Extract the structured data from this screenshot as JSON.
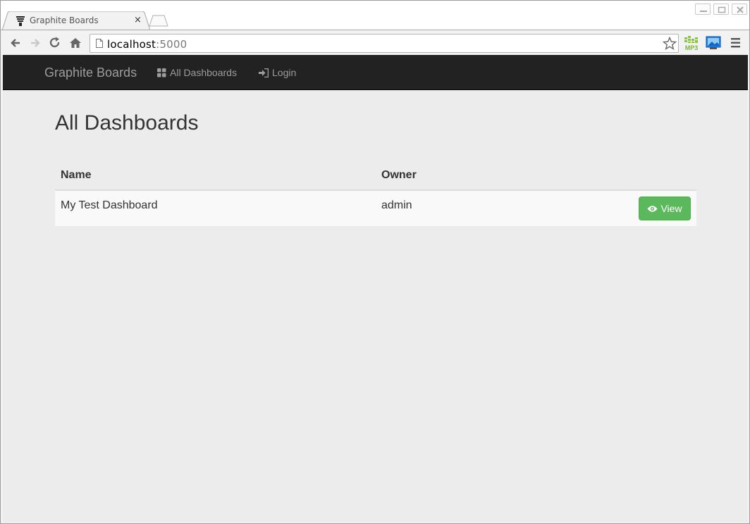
{
  "browser": {
    "tab_title": "Graphite Boards",
    "tab_close": "×",
    "url_host": "localhost",
    "url_port": ":5000",
    "extensions": [
      "mp3-extension-icon",
      "screenshot-extension-icon"
    ]
  },
  "navbar": {
    "brand": "Graphite Boards",
    "links": [
      {
        "label": "All Dashboards",
        "icon": "grid-icon"
      },
      {
        "label": "Login",
        "icon": "login-icon"
      }
    ]
  },
  "main": {
    "title": "All Dashboards",
    "table": {
      "headers": [
        "Name",
        "Owner",
        ""
      ],
      "rows": [
        {
          "name": "My Test Dashboard",
          "owner": "admin",
          "action": "View"
        }
      ]
    }
  },
  "colors": {
    "navbar_bg": "#222222",
    "page_bg": "#ececec",
    "view_button": "#5cb85c"
  }
}
